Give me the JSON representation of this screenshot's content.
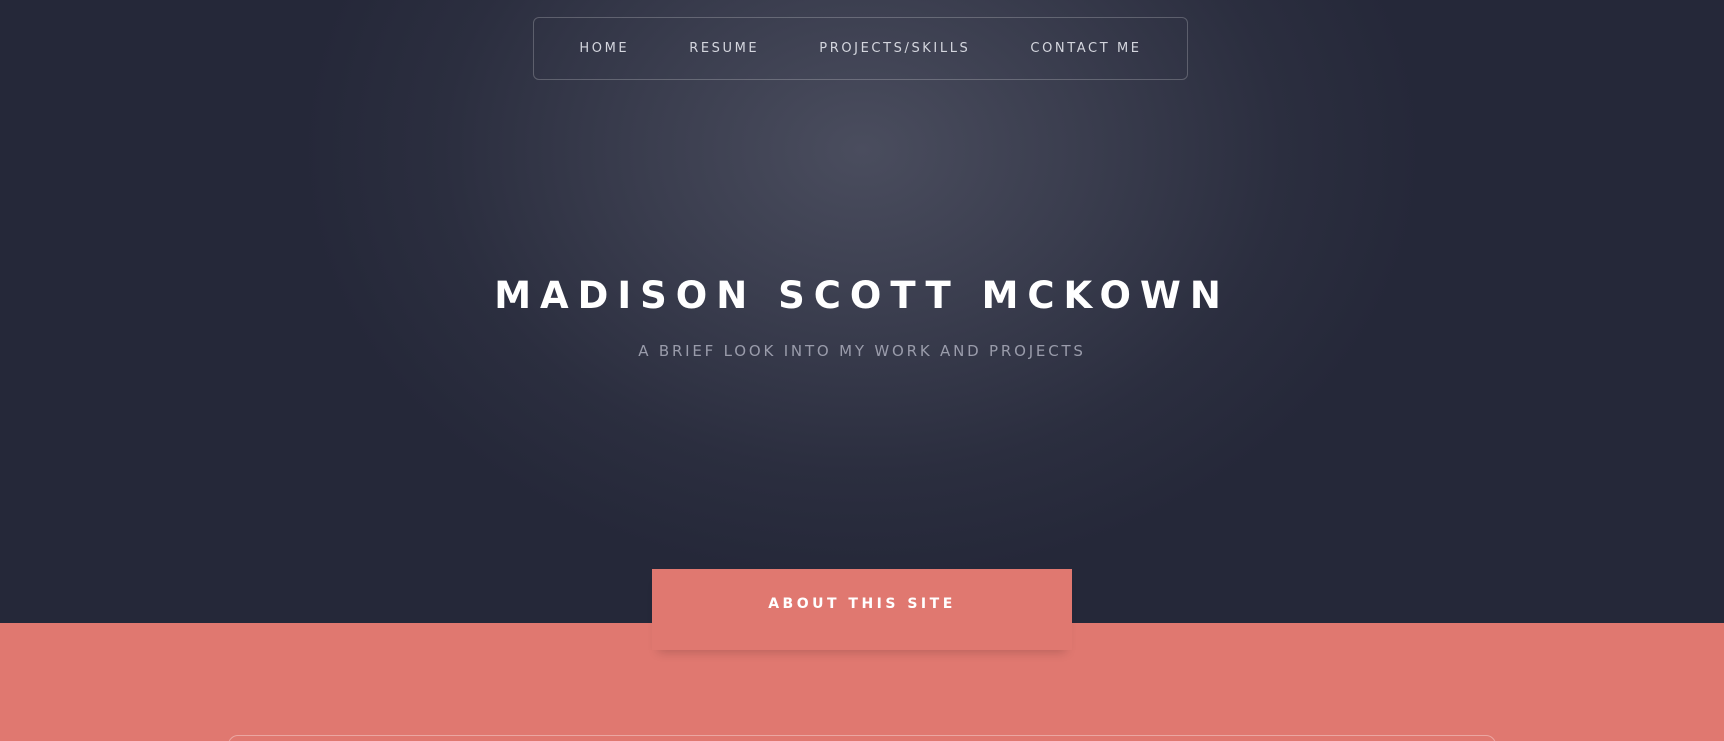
{
  "nav": {
    "items": [
      {
        "label": "HOME"
      },
      {
        "label": "RESUME"
      },
      {
        "label": "PROJECTS/SKILLS"
      },
      {
        "label": "CONTACT ME"
      }
    ]
  },
  "hero": {
    "title": "MADISON SCOTT MCKOWN",
    "subtitle": "A BRIEF LOOK INTO MY WORK AND PROJECTS"
  },
  "about": {
    "tab_label": "ABOUT THIS SITE"
  },
  "colors": {
    "hero_dark": "#2b2e3f",
    "accent_salmon": "#e07870",
    "title_white": "#ffffff"
  }
}
